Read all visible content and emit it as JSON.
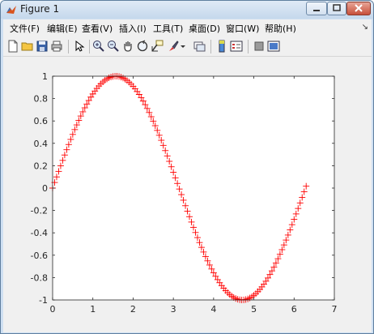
{
  "window": {
    "title": "Figure 1"
  },
  "menu": {
    "items": [
      {
        "label": "文件(F)"
      },
      {
        "label": "编辑(E)"
      },
      {
        "label": "查看(V)"
      },
      {
        "label": "插入(I)"
      },
      {
        "label": "工具(T)"
      },
      {
        "label": "桌面(D)"
      },
      {
        "label": "窗口(W)"
      },
      {
        "label": "帮助(H)"
      }
    ]
  },
  "toolbar": {
    "buttons": [
      "new-figure-icon",
      "open-file-icon",
      "save-icon",
      "print-icon",
      "pointer-icon",
      "zoom-in-icon",
      "zoom-out-icon",
      "pan-icon",
      "rotate-3d-icon",
      "data-cursor-icon",
      "brush-icon",
      "link-plot-icon",
      "colorbar-icon",
      "legend-icon",
      "hide-plot-tools-icon",
      "show-plot-tools-icon"
    ]
  },
  "colors": {
    "series": "#ff0000"
  },
  "chart_data": {
    "type": "scatter",
    "title": "",
    "xlabel": "",
    "ylabel": "",
    "xlim": [
      0,
      7
    ],
    "ylim": [
      -1,
      1
    ],
    "x_ticks": [
      "0",
      "1",
      "2",
      "3",
      "4",
      "5",
      "6",
      "7"
    ],
    "y_ticks": [
      "-1",
      "-0.8",
      "-0.6",
      "-0.4",
      "-0.2",
      "0",
      "0.2",
      "0.4",
      "0.6",
      "0.8",
      "1"
    ],
    "marker": "+",
    "grid": false,
    "series": [
      {
        "function": "sin(x)",
        "x_start": 0,
        "x_end": 6.28,
        "x_step": 0.05,
        "x": [
          0,
          0.5,
          1,
          1.5,
          2,
          2.5,
          3,
          3.5,
          4,
          4.5,
          5,
          5.5,
          6,
          6.28
        ],
        "y": [
          0,
          0.48,
          0.84,
          1.0,
          0.91,
          0.6,
          0.14,
          -0.35,
          -0.76,
          -0.98,
          -0.96,
          -0.71,
          -0.28,
          0
        ]
      }
    ]
  }
}
